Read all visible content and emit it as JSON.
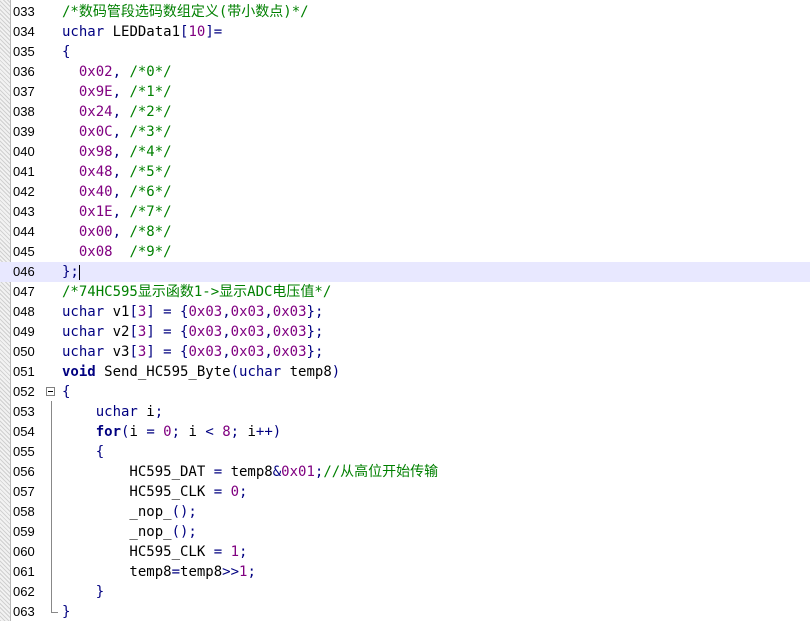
{
  "editor": {
    "colors": {
      "comment": "#008000",
      "keyword": "#000080",
      "number": "#800080",
      "current_line": "#e8e8ff"
    },
    "lines": [
      {
        "num": "033",
        "tokens": [
          {
            "t": "cm",
            "v": "/*数码管段选码数组定义(带小数点)*/"
          }
        ]
      },
      {
        "num": "034",
        "tokens": [
          {
            "t": "kw",
            "v": "uchar"
          },
          {
            "t": "id",
            "v": " LEDData1"
          },
          {
            "t": "op",
            "v": "["
          },
          {
            "t": "num",
            "v": "10"
          },
          {
            "t": "op",
            "v": "]="
          }
        ]
      },
      {
        "num": "035",
        "tokens": [
          {
            "t": "op",
            "v": "{"
          }
        ]
      },
      {
        "num": "036",
        "tokens": [
          {
            "t": "id",
            "v": "  "
          },
          {
            "t": "num",
            "v": "0x02"
          },
          {
            "t": "op",
            "v": ", "
          },
          {
            "t": "cm",
            "v": "/*0*/"
          }
        ]
      },
      {
        "num": "037",
        "tokens": [
          {
            "t": "id",
            "v": "  "
          },
          {
            "t": "num",
            "v": "0x9E"
          },
          {
            "t": "op",
            "v": ", "
          },
          {
            "t": "cm",
            "v": "/*1*/"
          }
        ]
      },
      {
        "num": "038",
        "tokens": [
          {
            "t": "id",
            "v": "  "
          },
          {
            "t": "num",
            "v": "0x24"
          },
          {
            "t": "op",
            "v": ", "
          },
          {
            "t": "cm",
            "v": "/*2*/"
          }
        ]
      },
      {
        "num": "039",
        "tokens": [
          {
            "t": "id",
            "v": "  "
          },
          {
            "t": "num",
            "v": "0x0C"
          },
          {
            "t": "op",
            "v": ", "
          },
          {
            "t": "cm",
            "v": "/*3*/"
          }
        ]
      },
      {
        "num": "040",
        "tokens": [
          {
            "t": "id",
            "v": "  "
          },
          {
            "t": "num",
            "v": "0x98"
          },
          {
            "t": "op",
            "v": ", "
          },
          {
            "t": "cm",
            "v": "/*4*/"
          }
        ]
      },
      {
        "num": "041",
        "tokens": [
          {
            "t": "id",
            "v": "  "
          },
          {
            "t": "num",
            "v": "0x48"
          },
          {
            "t": "op",
            "v": ", "
          },
          {
            "t": "cm",
            "v": "/*5*/"
          }
        ]
      },
      {
        "num": "042",
        "tokens": [
          {
            "t": "id",
            "v": "  "
          },
          {
            "t": "num",
            "v": "0x40"
          },
          {
            "t": "op",
            "v": ", "
          },
          {
            "t": "cm",
            "v": "/*6*/"
          }
        ]
      },
      {
        "num": "043",
        "tokens": [
          {
            "t": "id",
            "v": "  "
          },
          {
            "t": "num",
            "v": "0x1E"
          },
          {
            "t": "op",
            "v": ", "
          },
          {
            "t": "cm",
            "v": "/*7*/"
          }
        ]
      },
      {
        "num": "044",
        "tokens": [
          {
            "t": "id",
            "v": "  "
          },
          {
            "t": "num",
            "v": "0x00"
          },
          {
            "t": "op",
            "v": ", "
          },
          {
            "t": "cm",
            "v": "/*8*/"
          }
        ]
      },
      {
        "num": "045",
        "tokens": [
          {
            "t": "id",
            "v": "  "
          },
          {
            "t": "num",
            "v": "0x08"
          },
          {
            "t": "id",
            "v": "  "
          },
          {
            "t": "cm",
            "v": "/*9*/"
          }
        ]
      },
      {
        "num": "046",
        "current": true,
        "tokens": [
          {
            "t": "op",
            "v": "};"
          },
          {
            "t": "caret",
            "v": ""
          }
        ]
      },
      {
        "num": "047",
        "tokens": [
          {
            "t": "cm",
            "v": "/*74HC595显示函数1->显示ADC电压值*/"
          }
        ]
      },
      {
        "num": "048",
        "tokens": [
          {
            "t": "kw",
            "v": "uchar"
          },
          {
            "t": "id",
            "v": " v1"
          },
          {
            "t": "op",
            "v": "["
          },
          {
            "t": "num",
            "v": "3"
          },
          {
            "t": "op",
            "v": "] = {"
          },
          {
            "t": "num",
            "v": "0x03"
          },
          {
            "t": "op",
            "v": ","
          },
          {
            "t": "num",
            "v": "0x03"
          },
          {
            "t": "op",
            "v": ","
          },
          {
            "t": "num",
            "v": "0x03"
          },
          {
            "t": "op",
            "v": "};"
          }
        ]
      },
      {
        "num": "049",
        "tokens": [
          {
            "t": "kw",
            "v": "uchar"
          },
          {
            "t": "id",
            "v": " v2"
          },
          {
            "t": "op",
            "v": "["
          },
          {
            "t": "num",
            "v": "3"
          },
          {
            "t": "op",
            "v": "] = {"
          },
          {
            "t": "num",
            "v": "0x03"
          },
          {
            "t": "op",
            "v": ","
          },
          {
            "t": "num",
            "v": "0x03"
          },
          {
            "t": "op",
            "v": ","
          },
          {
            "t": "num",
            "v": "0x03"
          },
          {
            "t": "op",
            "v": "};"
          }
        ]
      },
      {
        "num": "050",
        "tokens": [
          {
            "t": "kw",
            "v": "uchar"
          },
          {
            "t": "id",
            "v": " v3"
          },
          {
            "t": "op",
            "v": "["
          },
          {
            "t": "num",
            "v": "3"
          },
          {
            "t": "op",
            "v": "] = {"
          },
          {
            "t": "num",
            "v": "0x03"
          },
          {
            "t": "op",
            "v": ","
          },
          {
            "t": "num",
            "v": "0x03"
          },
          {
            "t": "op",
            "v": ","
          },
          {
            "t": "num",
            "v": "0x03"
          },
          {
            "t": "op",
            "v": "};"
          }
        ]
      },
      {
        "num": "051",
        "tokens": [
          {
            "t": "kwb",
            "v": "void"
          },
          {
            "t": "id",
            "v": " Send_HC595_Byte"
          },
          {
            "t": "op",
            "v": "("
          },
          {
            "t": "kw",
            "v": "uchar"
          },
          {
            "t": "id",
            "v": " temp8"
          },
          {
            "t": "op",
            "v": ")"
          }
        ]
      },
      {
        "num": "052",
        "fold": "start",
        "tokens": [
          {
            "t": "op",
            "v": "{"
          }
        ]
      },
      {
        "num": "053",
        "tokens": [
          {
            "t": "id",
            "v": "    "
          },
          {
            "t": "kw",
            "v": "uchar"
          },
          {
            "t": "id",
            "v": " i"
          },
          {
            "t": "op",
            "v": ";"
          }
        ]
      },
      {
        "num": "054",
        "tokens": [
          {
            "t": "id",
            "v": "    "
          },
          {
            "t": "kwb",
            "v": "for"
          },
          {
            "t": "op",
            "v": "("
          },
          {
            "t": "id",
            "v": "i "
          },
          {
            "t": "op",
            "v": "= "
          },
          {
            "t": "num",
            "v": "0"
          },
          {
            "t": "op",
            "v": "; "
          },
          {
            "t": "id",
            "v": "i "
          },
          {
            "t": "op",
            "v": "< "
          },
          {
            "t": "num",
            "v": "8"
          },
          {
            "t": "op",
            "v": "; "
          },
          {
            "t": "id",
            "v": "i"
          },
          {
            "t": "op",
            "v": "++)"
          }
        ]
      },
      {
        "num": "055",
        "tokens": [
          {
            "t": "id",
            "v": "    "
          },
          {
            "t": "op",
            "v": "{"
          }
        ]
      },
      {
        "num": "056",
        "tokens": [
          {
            "t": "id",
            "v": "        HC595_DAT "
          },
          {
            "t": "op",
            "v": "= "
          },
          {
            "t": "id",
            "v": "temp8"
          },
          {
            "t": "op",
            "v": "&"
          },
          {
            "t": "num",
            "v": "0x01"
          },
          {
            "t": "op",
            "v": ";"
          },
          {
            "t": "cm",
            "v": "//从高位开始传输"
          }
        ]
      },
      {
        "num": "057",
        "tokens": [
          {
            "t": "id",
            "v": "        HC595_CLK "
          },
          {
            "t": "op",
            "v": "= "
          },
          {
            "t": "num",
            "v": "0"
          },
          {
            "t": "op",
            "v": ";"
          }
        ]
      },
      {
        "num": "058",
        "tokens": [
          {
            "t": "id",
            "v": "        _nop_"
          },
          {
            "t": "op",
            "v": "();"
          }
        ]
      },
      {
        "num": "059",
        "tokens": [
          {
            "t": "id",
            "v": "        _nop_"
          },
          {
            "t": "op",
            "v": "();"
          }
        ]
      },
      {
        "num": "060",
        "tokens": [
          {
            "t": "id",
            "v": "        HC595_CLK "
          },
          {
            "t": "op",
            "v": "= "
          },
          {
            "t": "num",
            "v": "1"
          },
          {
            "t": "op",
            "v": ";"
          }
        ]
      },
      {
        "num": "061",
        "tokens": [
          {
            "t": "id",
            "v": "        temp8"
          },
          {
            "t": "op",
            "v": "="
          },
          {
            "t": "id",
            "v": "temp8"
          },
          {
            "t": "op",
            "v": ">>"
          },
          {
            "t": "num",
            "v": "1"
          },
          {
            "t": "op",
            "v": ";"
          }
        ]
      },
      {
        "num": "062",
        "tokens": [
          {
            "t": "id",
            "v": "    "
          },
          {
            "t": "op",
            "v": "}"
          }
        ]
      },
      {
        "num": "063",
        "fold": "end",
        "tokens": [
          {
            "t": "op",
            "v": "}"
          }
        ]
      }
    ]
  }
}
